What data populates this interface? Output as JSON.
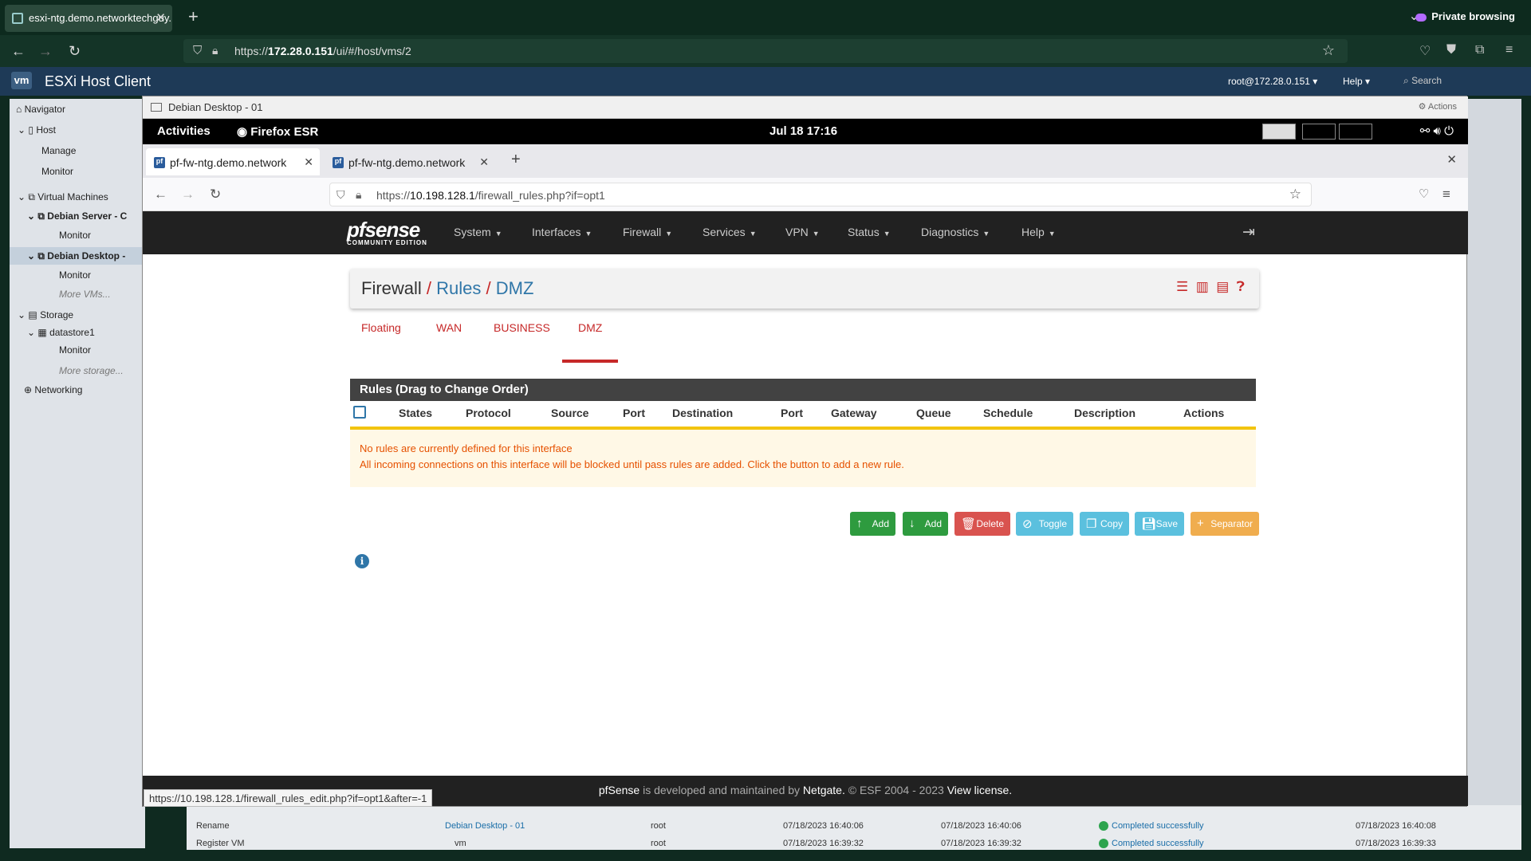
{
  "outer_browser": {
    "tab_title": "esxi-ntg.demo.networktechguy.",
    "url_prefix": "https://",
    "url_host": "172.28.0.151",
    "url_path": "/ui/#/host/vms/2",
    "private_label": "Private browsing"
  },
  "esxi": {
    "logo": "vm",
    "title": "ESXi Host Client",
    "user": "root@172.28.0.151 ▾",
    "help": "Help ▾",
    "search": "Search",
    "sidebar": {
      "navigator": "Navigator",
      "host": "Host",
      "manage": "Manage",
      "monitor": "Monitor",
      "virtual_machines": "Virtual Machines",
      "vm1": "Debian Server - C",
      "vm1_monitor": "Monitor",
      "vm2": "Debian Desktop -",
      "vm2_monitor": "Monitor",
      "more_vms": "More VMs...",
      "storage": "Storage",
      "datastore": "datastore1",
      "ds_monitor": "Monitor",
      "more_storage": "More storage...",
      "networking": "Networking"
    },
    "tasks": [
      {
        "task": "Rename",
        "target": "Debian Desktop - 01",
        "initiator": "root",
        "queued": "07/18/2023 16:40:06",
        "started": "07/18/2023 16:40:06",
        "result": "Completed successfully",
        "completed": "07/18/2023 16:40:08"
      },
      {
        "task": "Register VM",
        "target": "vm",
        "initiator": "root",
        "queued": "07/18/2023 16:39:32",
        "started": "07/18/2023 16:39:32",
        "result": "Completed successfully",
        "completed": "07/18/2023 16:39:33"
      }
    ]
  },
  "console": {
    "title": "Debian Desktop - 01",
    "actions": "⚙ Actions",
    "gnome": {
      "activities": "Activities",
      "app": "Firefox ESR",
      "clock": "Jul 18  17:16"
    },
    "tabs": [
      "pf-fw-ntg.demo.network",
      "pf-fw-ntg.demo.network"
    ],
    "url_prefix": "https://",
    "url_host": "10.198.128.1",
    "url_path": "/firewall_rules.php?if=opt1",
    "status_url": "https://10.198.128.1/firewall_rules_edit.php?if=opt1&after=-1"
  },
  "pfsense": {
    "logo": "pfsense",
    "logo_sub": "COMMUNITY EDITION",
    "menu": [
      "System",
      "Interfaces",
      "Firewall",
      "Services",
      "VPN",
      "Status",
      "Diagnostics",
      "Help"
    ],
    "breadcrumb": {
      "root": "Firewall",
      "sep": "/",
      "section": "Rules",
      "current": "DMZ"
    },
    "tabs": [
      "Floating",
      "WAN",
      "BUSINESS",
      "DMZ"
    ],
    "active_tab": "DMZ",
    "table_title": "Rules (Drag to Change Order)",
    "columns": [
      "States",
      "Protocol",
      "Source",
      "Port",
      "Destination",
      "Port",
      "Gateway",
      "Queue",
      "Schedule",
      "Description",
      "Actions"
    ],
    "warning_line1": "No rules are currently defined for this interface",
    "warning_line2": "All incoming connections on this interface will be blocked until pass rules are added. Click the button to add a new rule.",
    "buttons": [
      {
        "label": "Add",
        "icon": "arrow-up-icon",
        "color": "#2e9b3f"
      },
      {
        "label": "Add",
        "icon": "arrow-down-icon",
        "color": "#2e9b3f"
      },
      {
        "label": "Delete",
        "icon": "trash-icon",
        "color": "#d9534f"
      },
      {
        "label": "Toggle",
        "icon": "ban-icon",
        "color": "#5bc0de"
      },
      {
        "label": "Copy",
        "icon": "copy-icon",
        "color": "#5bc0de"
      },
      {
        "label": "Save",
        "icon": "save-icon",
        "color": "#5bc0de"
      },
      {
        "label": "Separator",
        "icon": "plus-icon",
        "color": "#f0ad4e"
      }
    ],
    "footer": {
      "brand": "pfSense",
      "text1": " is developed and maintained by ",
      "company": "Netgate.",
      "text2": " © ESF 2004 - 2023 ",
      "license": "View license."
    }
  }
}
